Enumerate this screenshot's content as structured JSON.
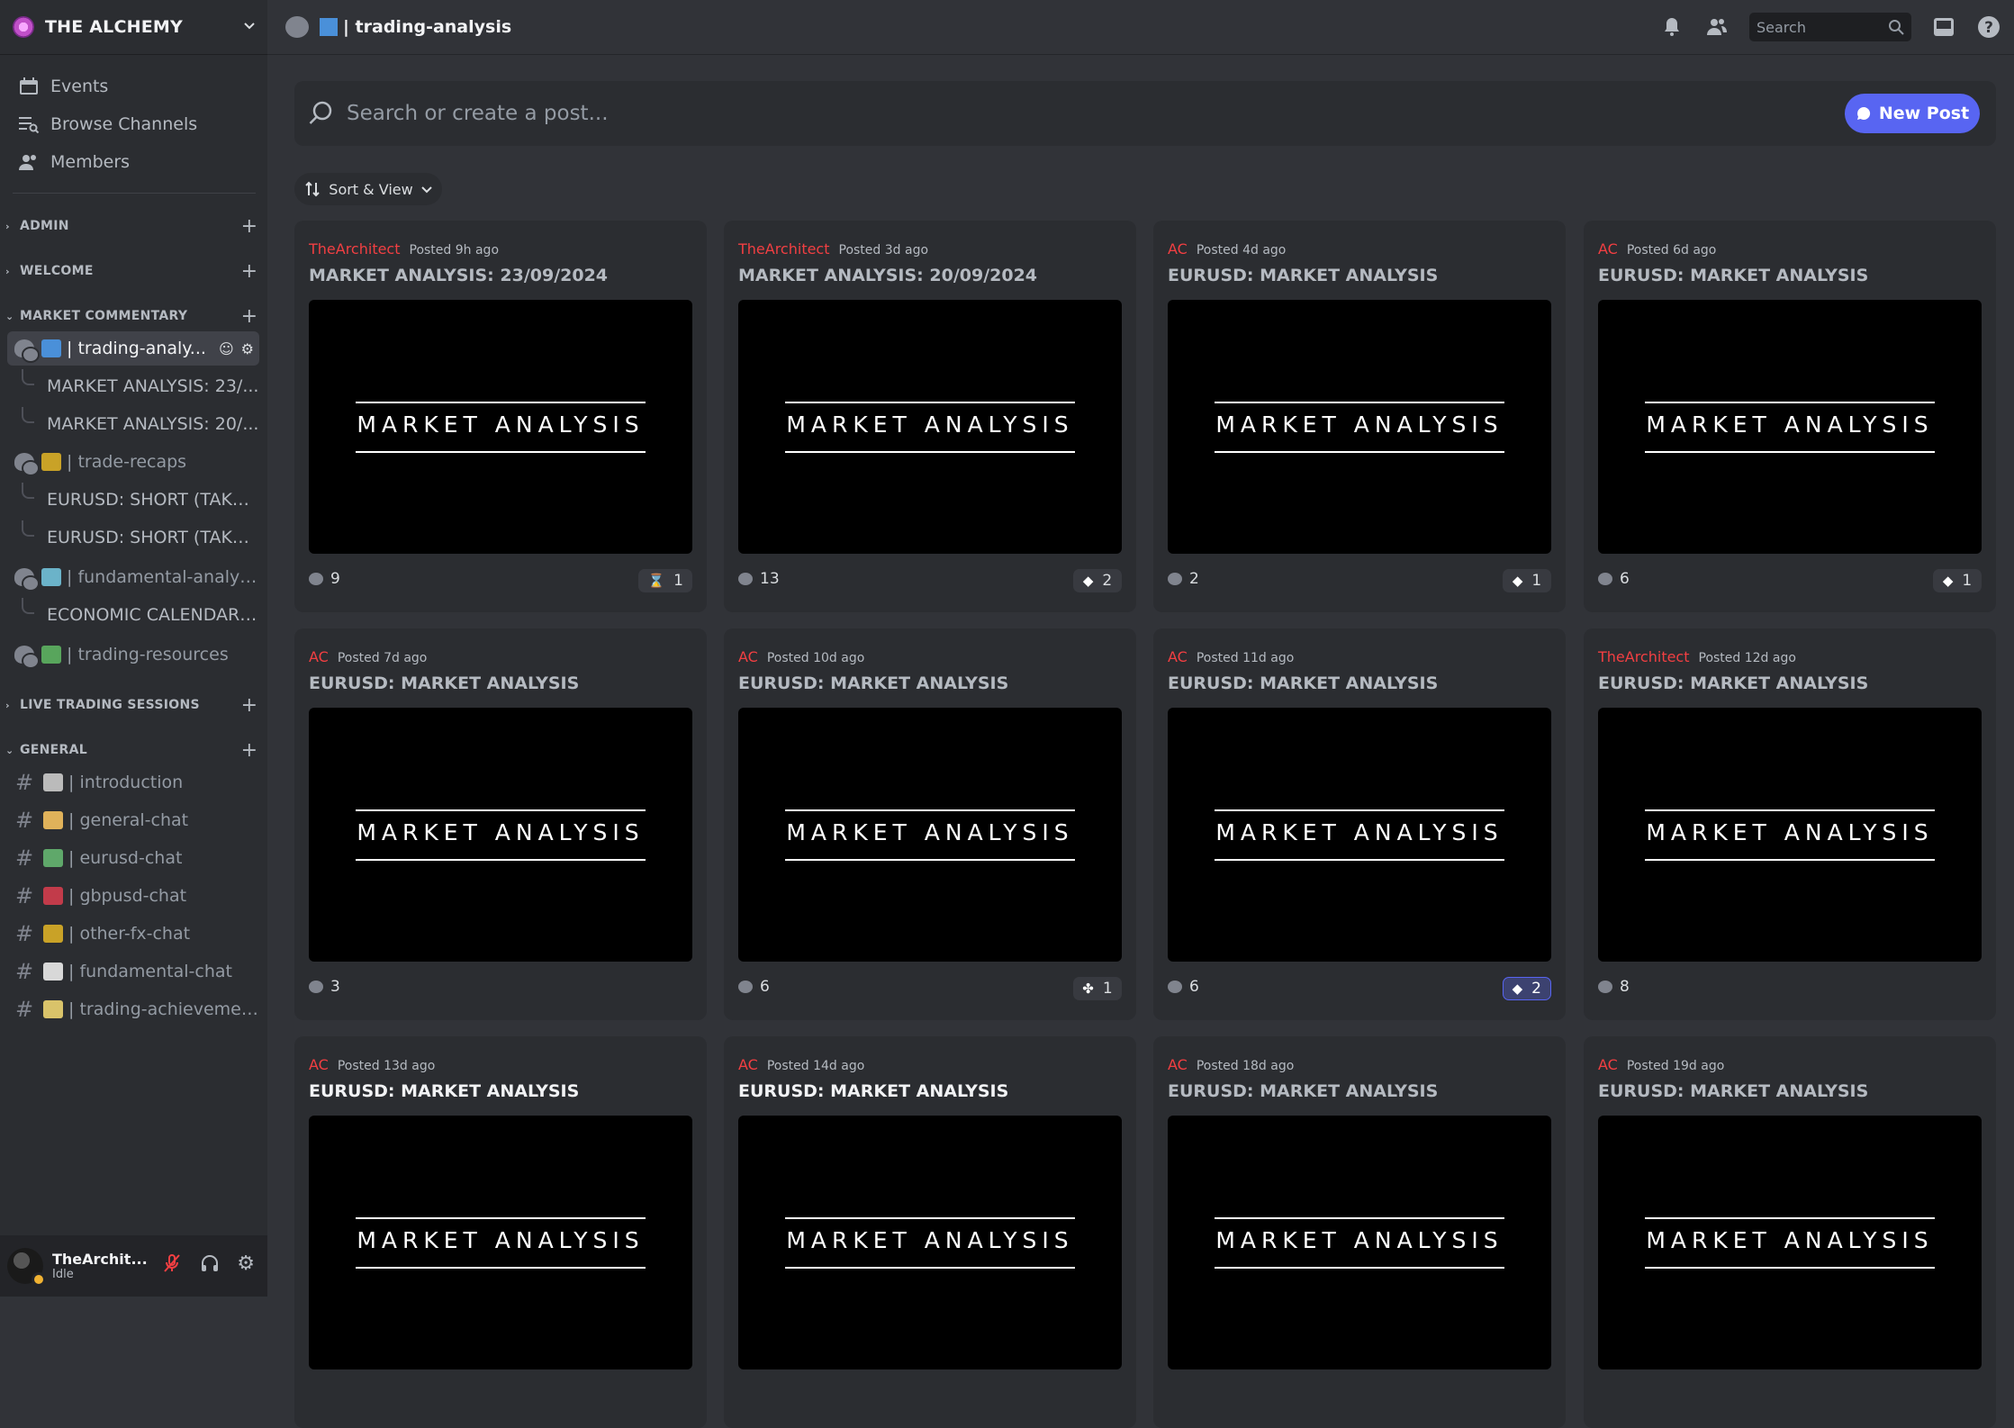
{
  "server": {
    "name": "THE ALCHEMY"
  },
  "nav": [
    {
      "label": "Events",
      "icon": "calendar-icon"
    },
    {
      "label": "Browse Channels",
      "icon": "browse-channels-icon"
    },
    {
      "label": "Members",
      "icon": "members-icon"
    }
  ],
  "categories": {
    "admin": "ADMIN",
    "welcome": "WELCOME",
    "market_commentary": "MARKET COMMENTARY",
    "live_trading": "LIVE TRADING SESSIONS",
    "general": "GENERAL"
  },
  "forum_channels": [
    {
      "name": "| trading-analysis",
      "display": "| trading-analy...",
      "emoji_color": "#4a90d9",
      "active": true,
      "threads": [
        "MARKET ANALYSIS: 23/...",
        "MARKET ANALYSIS: 20/..."
      ]
    },
    {
      "name": "| trade-recaps",
      "display": "| trade-recaps",
      "emoji_color": "#c9a227",
      "threads": [
        "EURUSD: SHORT (TAKEN)",
        "EURUSD: SHORT (TAKEN)"
      ]
    },
    {
      "name": "| fundamental-analysis",
      "display": "| fundamental-analysis",
      "emoji_color": "#6bb3c9",
      "threads": [
        "ECONOMIC CALENDAR ..."
      ]
    },
    {
      "name": "| trading-resources",
      "display": "| trading-resources",
      "emoji_color": "#58a55c",
      "threads": []
    }
  ],
  "general_channels": [
    {
      "name": "| introduction",
      "emoji_color": "#bbbbbb"
    },
    {
      "name": "| general-chat",
      "emoji_color": "#e0b25a"
    },
    {
      "name": "| eurusd-chat",
      "emoji_color": "#5fa86a"
    },
    {
      "name": "| gbpusd-chat",
      "emoji_color": "#c23b4a"
    },
    {
      "name": "| other-fx-chat",
      "emoji_color": "#c9a227"
    },
    {
      "name": "| fundamental-chat",
      "emoji_color": "#d8d8d8"
    },
    {
      "name": "| trading-achievemen...",
      "emoji_color": "#d9c36a"
    }
  ],
  "user": {
    "name": "TheArchit...",
    "status": "Idle"
  },
  "topbar": {
    "channel": "| trading-analysis",
    "search_placeholder": "Search"
  },
  "forum": {
    "search_placeholder": "Search or create a post...",
    "new_post": "New Post",
    "sort_label": "Sort & View",
    "thumb_text": "MARKET ANALYSIS"
  },
  "posts": [
    {
      "author": "TheArchitect",
      "posted": "Posted 9h ago",
      "title": "MARKET ANALYSIS: 23/09/2024",
      "comments": "9",
      "reaction": "1",
      "reaction_icon": "hourglass-icon",
      "reaction_glyph": "⌛",
      "unread": false
    },
    {
      "author": "TheArchitect",
      "posted": "Posted 3d ago",
      "title": "MARKET ANALYSIS: 20/09/2024",
      "comments": "13",
      "reaction": "2",
      "reaction_icon": "gem-icon",
      "reaction_glyph": "◆",
      "unread": false
    },
    {
      "author": "AC",
      "posted": "Posted 4d ago",
      "title": "EURUSD: MARKET ANALYSIS",
      "comments": "2",
      "reaction": "1",
      "reaction_icon": "gem-icon",
      "reaction_glyph": "◆",
      "unread": false
    },
    {
      "author": "AC",
      "posted": "Posted 6d ago",
      "title": "EURUSD: MARKET ANALYSIS",
      "comments": "6",
      "reaction": "1",
      "reaction_icon": "gem-icon",
      "reaction_glyph": "◆",
      "unread": false
    },
    {
      "author": "AC",
      "posted": "Posted 7d ago",
      "title": "EURUSD: MARKET ANALYSIS",
      "comments": "3",
      "reaction": null,
      "unread": false
    },
    {
      "author": "AC",
      "posted": "Posted 10d ago",
      "title": "EURUSD: MARKET ANALYSIS",
      "comments": "6",
      "reaction": "1",
      "reaction_icon": "clover-icon",
      "reaction_glyph": "✤",
      "unread": false
    },
    {
      "author": "AC",
      "posted": "Posted 11d ago",
      "title": "EURUSD: MARKET ANALYSIS",
      "comments": "6",
      "reaction": "2",
      "reaction_icon": "gem-icon",
      "reaction_glyph": "◆",
      "reacted": true,
      "unread": false
    },
    {
      "author": "TheArchitect",
      "posted": "Posted 12d ago",
      "title": "EURUSD: MARKET ANALYSIS",
      "comments": "8",
      "reaction": null,
      "unread": false
    },
    {
      "author": "AC",
      "posted": "Posted 13d ago",
      "title": "EURUSD: MARKET ANALYSIS",
      "comments": "",
      "reaction": null,
      "unread": true
    },
    {
      "author": "AC",
      "posted": "Posted 14d ago",
      "title": "EURUSD: MARKET ANALYSIS",
      "comments": "",
      "reaction": null,
      "unread": true
    },
    {
      "author": "AC",
      "posted": "Posted 18d ago",
      "title": "EURUSD: MARKET ANALYSIS",
      "comments": "",
      "reaction": null,
      "unread": false
    },
    {
      "author": "AC",
      "posted": "Posted 19d ago",
      "title": "EURUSD: MARKET ANALYSIS",
      "comments": "",
      "reaction": null,
      "unread": false
    }
  ],
  "colors": {
    "accent": "#5865f2",
    "author": "#f23f42",
    "idle": "#f0b232"
  }
}
